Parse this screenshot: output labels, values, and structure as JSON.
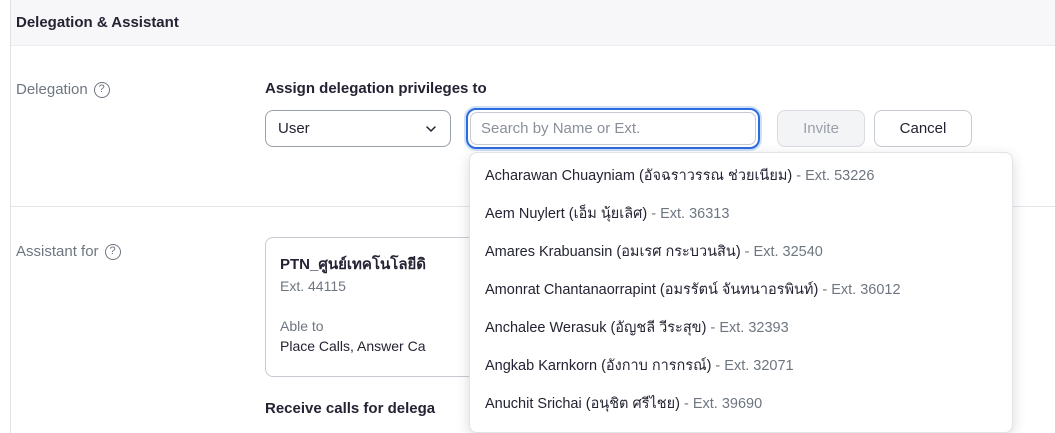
{
  "section": {
    "title": "Delegation & Assistant"
  },
  "delegation": {
    "label": "Delegation",
    "help_icon": "?",
    "heading": "Assign delegation privileges to",
    "select_value": "User",
    "search_placeholder": "Search by Name or Ext.",
    "invite_label": "Invite",
    "cancel_label": "Cancel"
  },
  "assistant": {
    "label": "Assistant for",
    "help_icon": "?",
    "card": {
      "title": "PTN_ศูนย์เทคโนโลยีดิ",
      "ext": "Ext. 44115",
      "able_label": "Able to",
      "permissions": "Place Calls, Answer Ca"
    },
    "receive_heading": "Receive calls for delega"
  },
  "dropdown": {
    "options": [
      {
        "name": "Acharawan Chuayniam (อัจฉราวรรณ ช่วยเนียม)",
        "ext": "Ext. 53226"
      },
      {
        "name": "Aem Nuylert (เอ็ม นุ้ยเลิศ)",
        "ext": "Ext. 36313"
      },
      {
        "name": "Amares Krabuansin (อมเรศ กระบวนสิน)",
        "ext": "Ext. 32540"
      },
      {
        "name": "Amonrat Chantanaorrapint (อมรรัตน์ จันทนาอรพินท์)",
        "ext": "Ext. 36012"
      },
      {
        "name": "Anchalee Werasuk (อัญชลี วีระสุข)",
        "ext": "Ext. 32393"
      },
      {
        "name": "Angkab Karnkorn (อังกาบ การกรณ์)",
        "ext": "Ext. 32071"
      },
      {
        "name": "Anuchit Srichai (อนุชิต ศรีไชย)",
        "ext": "Ext. 39690"
      }
    ],
    "separator": " - "
  },
  "icons": {
    "help": "help-circle-icon",
    "select_chevron": "chevron-down-icon"
  },
  "colors": {
    "focus_blue": "#2d6cdf",
    "muted_text": "#6e7680",
    "header_bg": "#f7f7fa"
  }
}
